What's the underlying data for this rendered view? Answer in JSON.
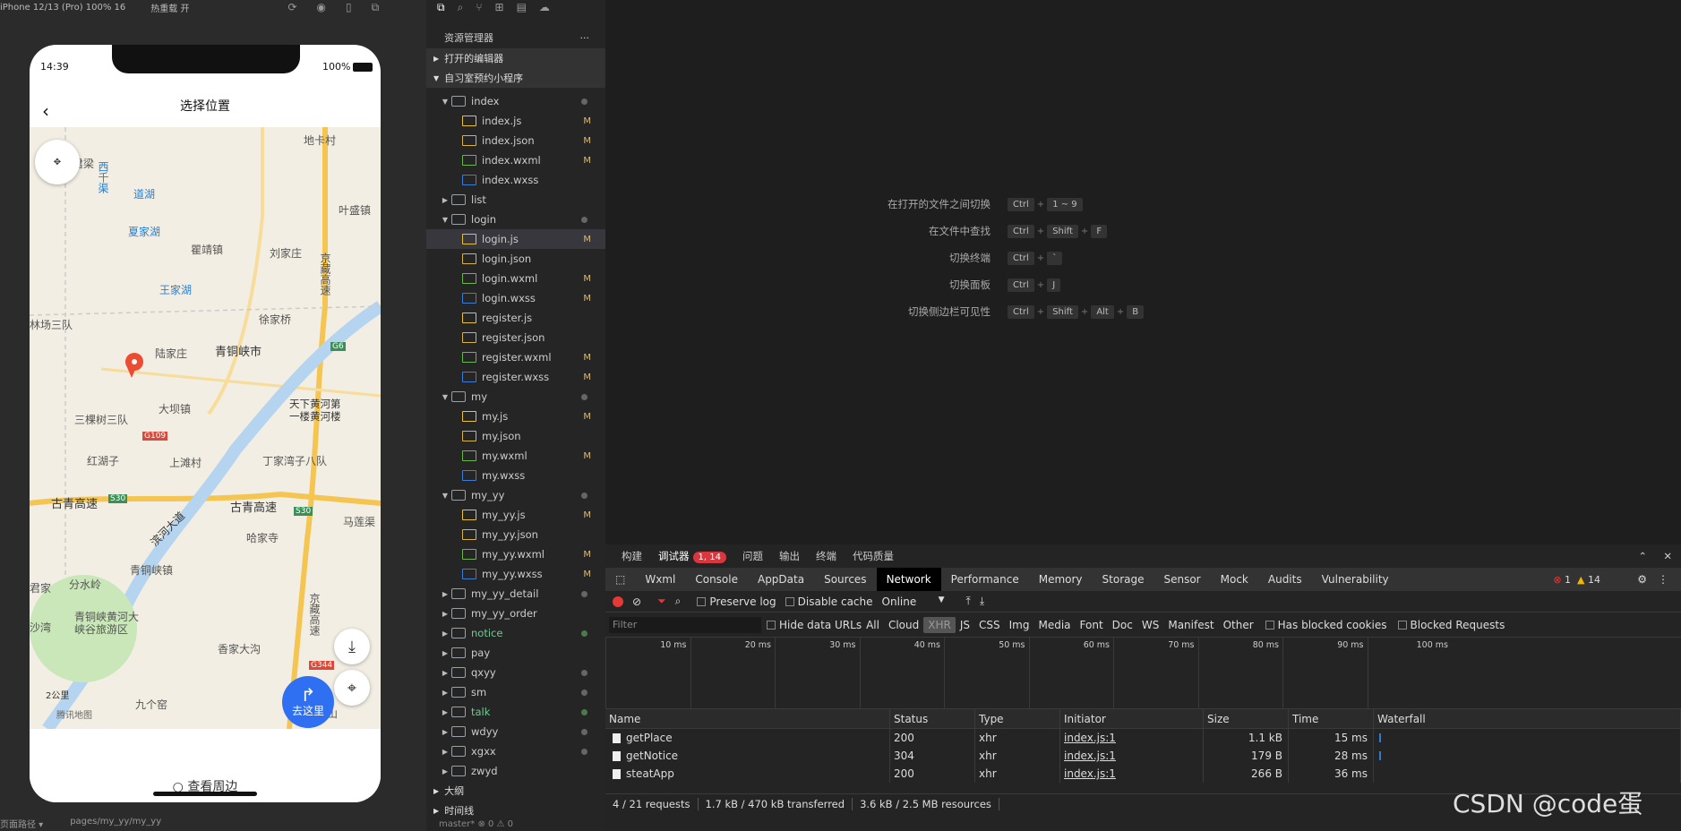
{
  "simulator": {
    "device": "iPhone 12/13 (Pro) 100% 16",
    "hotreload": "热重载 开",
    "time": "14:39",
    "battery": "100%",
    "nav_title": "选择位置",
    "map_labels": [
      "地卡村",
      "西千渠",
      "道湖",
      "夏家湖",
      "叶盛镇",
      "瞿靖镇",
      "刘家庄",
      "京藏高速",
      "王家湖",
      "林场三队",
      "徐家桥",
      "陆家庄",
      "青铜峡市",
      "G6",
      "天下黄河第一楼黄河楼",
      "三棵树三队",
      "大坝镇",
      "G109",
      "红湖子",
      "上滩村",
      "丁家湾子八队",
      "古青高速",
      "S30",
      "古青高速",
      "滨河大道",
      "哈家寺",
      "马莲渠",
      "分水岭",
      "S30",
      "青铜峡镇",
      "京藏高速",
      "青铜峡黄河大峡谷旅游区",
      "香家大沟",
      "G344",
      "沙湾",
      "九个窑",
      "五山",
      "2公里",
      "腾讯地图",
      "君梁",
      "君家"
    ],
    "go_label": "去这里",
    "look_label": "查看周边",
    "footer_path": "页面路径 ▾",
    "footer_page": "pages/my_yy/my_yy"
  },
  "explorer": {
    "title": "资源管理器",
    "more": "···",
    "open_editors": "打开的编辑器",
    "project": "自习室预约小程序",
    "rows": [
      {
        "label": "index",
        "type": "folder-open",
        "indent": 1,
        "dot": "grey"
      },
      {
        "label": "index.js",
        "type": "js",
        "indent": 2,
        "badge": "M"
      },
      {
        "label": "index.json",
        "type": "json",
        "indent": 2,
        "badge": "M"
      },
      {
        "label": "index.wxml",
        "type": "wxml",
        "indent": 2,
        "badge": "M"
      },
      {
        "label": "index.wxss",
        "type": "wxss",
        "indent": 2,
        "badge": ""
      },
      {
        "label": "list",
        "type": "folder",
        "indent": 1,
        "dot": ""
      },
      {
        "label": "login",
        "type": "folder-open",
        "indent": 1,
        "dot": "grey"
      },
      {
        "label": "login.js",
        "type": "js",
        "indent": 2,
        "badge": "M",
        "selected": true
      },
      {
        "label": "login.json",
        "type": "json",
        "indent": 2,
        "badge": ""
      },
      {
        "label": "login.wxml",
        "type": "wxml",
        "indent": 2,
        "badge": "M"
      },
      {
        "label": "login.wxss",
        "type": "wxss",
        "indent": 2,
        "badge": "M"
      },
      {
        "label": "register.js",
        "type": "js",
        "indent": 2,
        "badge": ""
      },
      {
        "label": "register.json",
        "type": "json",
        "indent": 2,
        "badge": ""
      },
      {
        "label": "register.wxml",
        "type": "wxml",
        "indent": 2,
        "badge": "M"
      },
      {
        "label": "register.wxss",
        "type": "wxss",
        "indent": 2,
        "badge": "M"
      },
      {
        "label": "my",
        "type": "folder-open",
        "indent": 1,
        "dot": "grey"
      },
      {
        "label": "my.js",
        "type": "js",
        "indent": 2,
        "badge": "M"
      },
      {
        "label": "my.json",
        "type": "json",
        "indent": 2,
        "badge": ""
      },
      {
        "label": "my.wxml",
        "type": "wxml",
        "indent": 2,
        "badge": "M"
      },
      {
        "label": "my.wxss",
        "type": "wxss",
        "indent": 2,
        "badge": ""
      },
      {
        "label": "my_yy",
        "type": "folder-open",
        "indent": 1,
        "dot": "grey"
      },
      {
        "label": "my_yy.js",
        "type": "js",
        "indent": 2,
        "badge": "M"
      },
      {
        "label": "my_yy.json",
        "type": "json",
        "indent": 2,
        "badge": ""
      },
      {
        "label": "my_yy.wxml",
        "type": "wxml",
        "indent": 2,
        "badge": "M"
      },
      {
        "label": "my_yy.wxss",
        "type": "wxss",
        "indent": 2,
        "badge": "M"
      },
      {
        "label": "my_yy_detail",
        "type": "folder",
        "indent": 1,
        "dot": "grey"
      },
      {
        "label": "my_yy_order",
        "type": "folder",
        "indent": 1,
        "dot": ""
      },
      {
        "label": "notice",
        "type": "folder",
        "indent": 1,
        "dot": "green",
        "green": true
      },
      {
        "label": "pay",
        "type": "folder",
        "indent": 1,
        "dot": ""
      },
      {
        "label": "qxyy",
        "type": "folder",
        "indent": 1,
        "dot": "grey"
      },
      {
        "label": "sm",
        "type": "folder",
        "indent": 1,
        "dot": "grey"
      },
      {
        "label": "talk",
        "type": "folder",
        "indent": 1,
        "dot": "green",
        "green": true
      },
      {
        "label": "wdyy",
        "type": "folder",
        "indent": 1,
        "dot": "grey"
      },
      {
        "label": "xgxx",
        "type": "folder",
        "indent": 1,
        "dot": "grey"
      },
      {
        "label": "zwyd",
        "type": "folder",
        "indent": 1,
        "dot": ""
      }
    ],
    "outline": "大纲",
    "timeline": "时间线",
    "footer": "master*   ⊗ 0 ⚠ 0"
  },
  "editor": {
    "hints": [
      {
        "label": "在打开的文件之间切换",
        "keys": [
          "Ctrl",
          "1 ~ 9"
        ]
      },
      {
        "label": "在文件中查找",
        "keys": [
          "Ctrl",
          "Shift",
          "F"
        ]
      },
      {
        "label": "切换终端",
        "keys": [
          "Ctrl",
          "`"
        ]
      },
      {
        "label": "切换面板",
        "keys": [
          "Ctrl",
          "J"
        ]
      },
      {
        "label": "切换侧边栏可见性",
        "keys": [
          "Ctrl",
          "Shift",
          "Alt",
          "B"
        ]
      }
    ]
  },
  "devtools": {
    "top_tabs": [
      "构建",
      "调试器",
      "问题",
      "输出",
      "终端",
      "代码质量"
    ],
    "debugger_badge": "1, 14",
    "tabs": [
      "Wxml",
      "Console",
      "AppData",
      "Sources",
      "Network",
      "Performance",
      "Memory",
      "Storage",
      "Sensor",
      "Mock",
      "Audits",
      "Vulnerability"
    ],
    "active_tab": "Network",
    "errors": "1",
    "warnings": "14",
    "preserve_log": "Preserve log",
    "disable_cache": "Disable cache",
    "throttle": "Online",
    "filter_placeholder": "Filter",
    "hide_data_urls": "Hide data URLs",
    "types": [
      "All",
      "Cloud",
      "XHR",
      "JS",
      "CSS",
      "Img",
      "Media",
      "Font",
      "Doc",
      "WS",
      "Manifest",
      "Other"
    ],
    "has_blocked": "Has blocked cookies",
    "blocked_requests": "Blocked Requests",
    "ticks": [
      "10 ms",
      "20 ms",
      "30 ms",
      "40 ms",
      "50 ms",
      "60 ms",
      "70 ms",
      "80 ms",
      "90 ms",
      "100 ms"
    ],
    "columns": [
      "Name",
      "Status",
      "Type",
      "Initiator",
      "Size",
      "Time",
      "Waterfall"
    ],
    "rows": [
      {
        "name": "getPlace",
        "status": "200",
        "type": "xhr",
        "initiator": "index.js:1",
        "size": "1.1 kB",
        "time": "15 ms"
      },
      {
        "name": "getNotice",
        "status": "304",
        "type": "xhr",
        "initiator": "index.js:1",
        "size": "179 B",
        "time": "28 ms"
      },
      {
        "name": "steatApp",
        "status": "200",
        "type": "xhr",
        "initiator": "index.js:1",
        "size": "266 B",
        "time": "36 ms"
      }
    ],
    "summary": [
      "4 / 21 requests",
      "1.7 kB / 470 kB transferred",
      "3.6 kB / 2.5 MB resources"
    ]
  },
  "watermark": "CSDN @code蛋"
}
